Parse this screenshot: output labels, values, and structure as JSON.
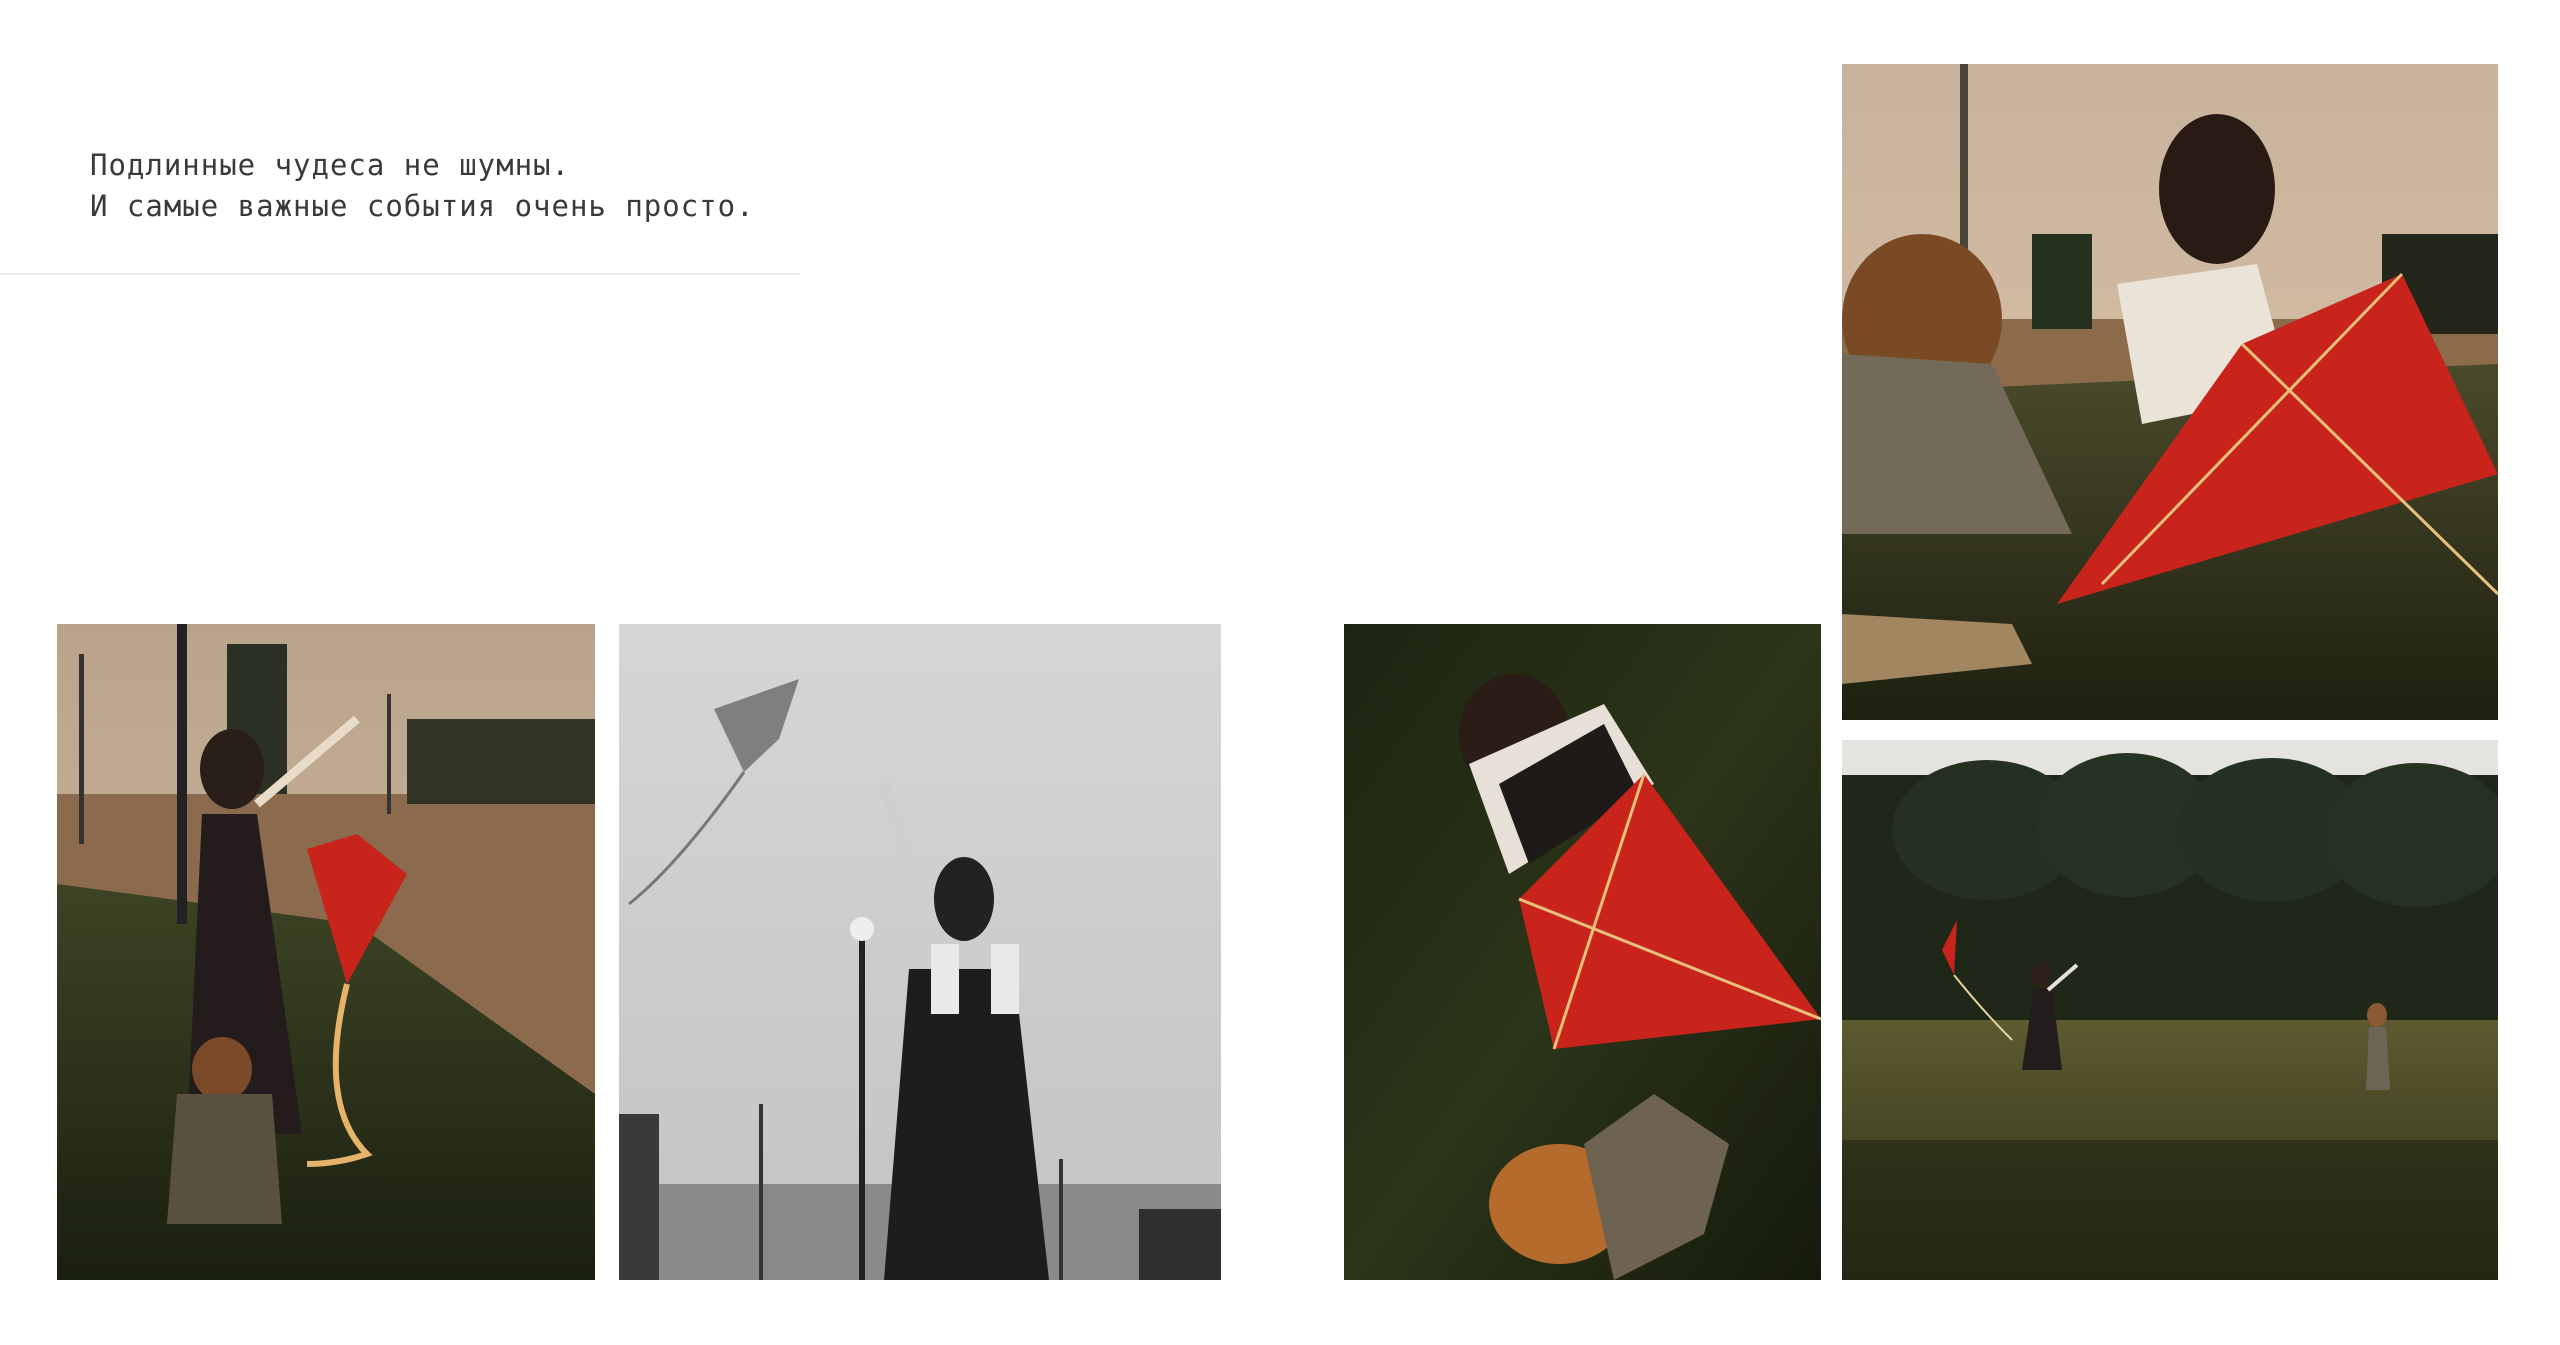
{
  "quote": {
    "line1": "Подлинные чудеса не шумны.",
    "line2": "И самые важные события очень просто."
  },
  "photos": [
    {
      "icon": "photo-kite-field-evening"
    },
    {
      "icon": "photo-kite-sky-bw"
    },
    {
      "icon": "photo-red-kite-grass-topdown"
    },
    {
      "icon": "photo-mother-child-red-kite"
    },
    {
      "icon": "photo-kite-running-park"
    }
  ],
  "colors": {
    "kite_red": "#c8241c",
    "grass_dark": "#2a301a",
    "sky_warm": "#d9c3a6",
    "text": "#3a3a3a"
  }
}
